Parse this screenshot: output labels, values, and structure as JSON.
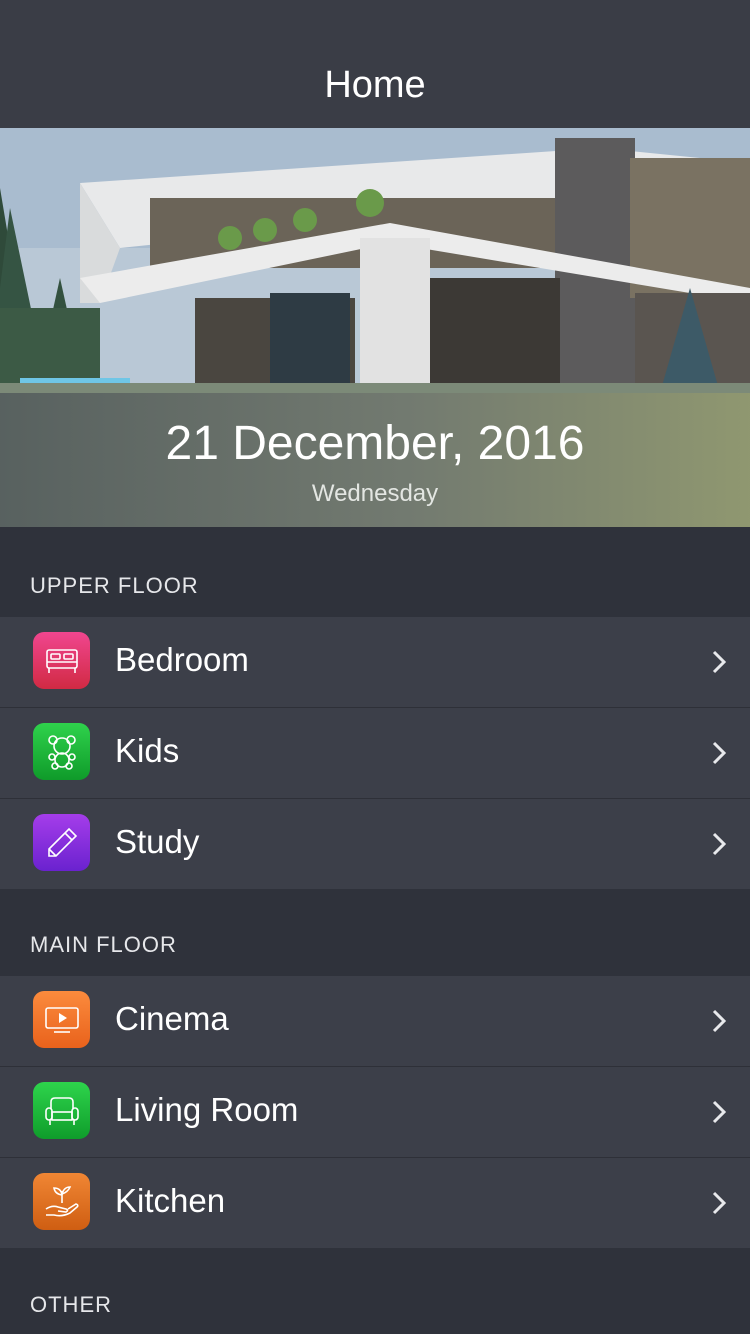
{
  "nav": {
    "title": "Home"
  },
  "hero": {
    "date": "21 December, 2016",
    "weekday": "Wednesday"
  },
  "sections": [
    {
      "header": "UPPER FLOOR",
      "rooms": [
        {
          "label": "Bedroom",
          "icon": "bed-icon",
          "color": "#e0356a"
        },
        {
          "label": "Kids",
          "icon": "teddy-bear-icon",
          "color": "#1fb83b"
        },
        {
          "label": "Study",
          "icon": "pencil-icon",
          "color": "#8a2fe0"
        }
      ]
    },
    {
      "header": "MAIN FLOOR",
      "rooms": [
        {
          "label": "Cinema",
          "icon": "tv-play-icon",
          "color": "#f2762a"
        },
        {
          "label": "Living Room",
          "icon": "armchair-icon",
          "color": "#1fb83b"
        },
        {
          "label": "Kitchen",
          "icon": "plant-hand-icon",
          "color": "#e07020"
        }
      ]
    },
    {
      "header": "OTHER"
    }
  ]
}
